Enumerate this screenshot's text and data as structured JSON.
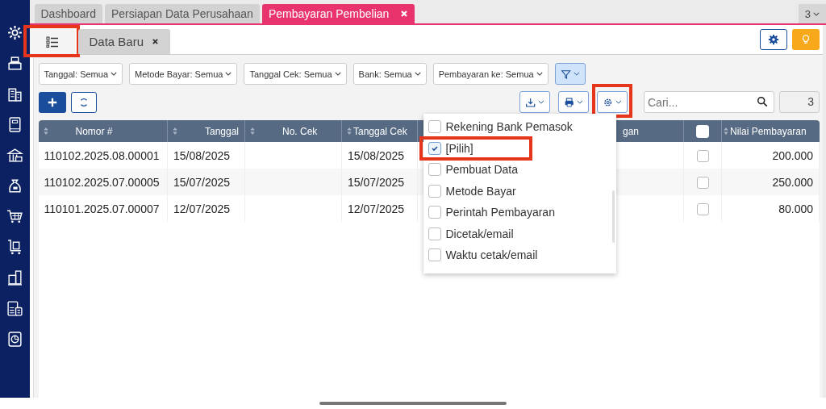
{
  "tabs": [
    {
      "label": "Dashboard",
      "selected": false,
      "closable": false
    },
    {
      "label": "Persiapan Data Perusahaan",
      "selected": false,
      "closable": false
    },
    {
      "label": "Pembayaran Pembelian",
      "selected": true,
      "closable": true
    }
  ],
  "tab_overflow": "3",
  "subtabs": [
    {
      "kind": "list",
      "selected": true,
      "highlighted": true
    },
    {
      "kind": "text",
      "label": "Data Baru",
      "selected": false,
      "highlighted": false
    }
  ],
  "filters": [
    "Tanggal: Semua",
    "Metode Bayar: Semua",
    "Tanggal Cek: Semua",
    "Bank: Semua",
    "Pembayaran ke: Semua"
  ],
  "tools": [
    {
      "kind": "download",
      "highlighted": false
    },
    {
      "kind": "print",
      "highlighted": false
    },
    {
      "kind": "columns",
      "highlighted": true
    }
  ],
  "search": {
    "placeholder": "Cari..."
  },
  "record_count": "3",
  "table": {
    "columns": [
      {
        "kind": "text",
        "label": "Nomor #",
        "sortable": true
      },
      {
        "kind": "text",
        "label": "Tanggal",
        "sortable": true
      },
      {
        "kind": "text",
        "label": "No. Cek",
        "sortable": true
      },
      {
        "kind": "text",
        "label": "Tanggal Cek",
        "sortable": true
      },
      {
        "kind": "text",
        "label": "gan",
        "sortable": false
      },
      {
        "kind": "checkbox",
        "checked": false
      },
      {
        "kind": "text",
        "label": "Nilai Pembayaran",
        "sortable": true
      }
    ],
    "rows": [
      {
        "nomor": "110102.2025.08.00001",
        "tanggal": "15/08/2025",
        "tanggal_cek": "15/08/2025",
        "checked": false,
        "nilai": "200.000"
      },
      {
        "nomor": "110102.2025.07.00005",
        "tanggal": "15/07/2025",
        "tanggal_cek": "15/07/2025",
        "checked": false,
        "nilai": "250.000"
      },
      {
        "nomor": "110101.2025.07.00007",
        "tanggal": "12/07/2025",
        "tanggal_cek": "12/07/2025",
        "checked": false,
        "nilai": "80.000"
      }
    ]
  },
  "column_menu": [
    {
      "label": "Rekening Bank Pemasok",
      "checked": false,
      "highlighted": false
    },
    {
      "label": "[Pilih]",
      "checked": true,
      "highlighted": true
    },
    {
      "label": "Pembuat Data",
      "checked": false,
      "highlighted": false
    },
    {
      "label": "Metode Bayar",
      "checked": false,
      "highlighted": false
    },
    {
      "label": "Perintah Pembayaran",
      "checked": false,
      "highlighted": false
    },
    {
      "label": "Dicetak/email",
      "checked": false,
      "highlighted": false
    },
    {
      "label": "Waktu cetak/email",
      "checked": false,
      "highlighted": false
    }
  ]
}
